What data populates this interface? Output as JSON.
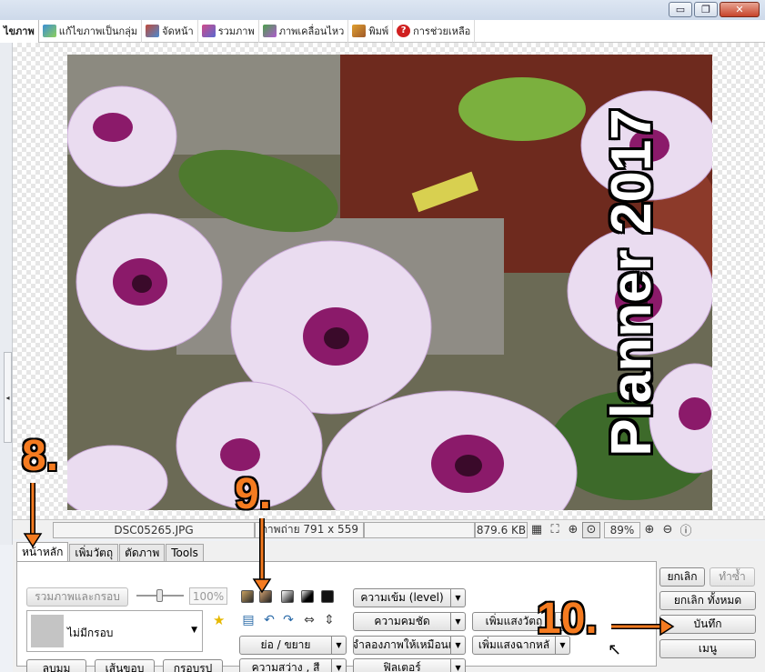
{
  "window": {
    "minimize_label": "▭",
    "restore_label": "❐",
    "close_label": "✕"
  },
  "menu": {
    "items": [
      {
        "label": "ไขภาพ",
        "icon": "edit-image-icon"
      },
      {
        "label": "แก้ไขภาพเป็นกลุ่ม",
        "icon": "batch-edit-icon"
      },
      {
        "label": "จัดหน้า",
        "icon": "page-layout-icon"
      },
      {
        "label": "รวมภาพ",
        "icon": "combine-icon"
      },
      {
        "label": "ภาพเคลื่อนไหว",
        "icon": "animation-icon"
      },
      {
        "label": "พิมพ์",
        "icon": "print-icon"
      },
      {
        "label": "การช่วยเหลือ",
        "icon": "help-icon"
      }
    ]
  },
  "photo": {
    "overlay_text": "Planner 2017"
  },
  "status": {
    "filename": "DSC05265.JPG",
    "dimensions": "ภาพถ่าย 791 x 559",
    "filesize": "879.6 KB",
    "zoom": "89%"
  },
  "tabs": [
    "หน้าหลัก",
    "เพิ่มวัตถุ",
    "ตัดภาพ",
    "Tools"
  ],
  "main_tab": {
    "merge_frame_label": "รวมภาพและกรอบ",
    "opacity_value": "100%",
    "frame_select": "ไม่มีกรอบ",
    "corner_label": "ลบมุม",
    "border_label": "เส้นขอบ",
    "frame_shape_label": "กรอบรูป",
    "resize_label": "ย่อ / ขยาย",
    "brightness_label": "ความสว่าง , สี",
    "level_label": "ความเข้ม (level)",
    "sharpness_label": "ความคมชัด",
    "simulate_label": "จำลองภาพให้เหมือนเ",
    "filter_label": "ฟิลเตอร์",
    "add_object_light_label": "เพิ่มแสงวัตถุ",
    "add_bg_light_label": "เพิ่มแสงฉากหลั"
  },
  "actions": {
    "cancel_label": "ยกเลิก",
    "redo_label": "ทำซ้ำ",
    "cancel_all_label": "ยกเลิก ทั้งหมด",
    "save_label": "บันทึก",
    "menu_label": "เมนู"
  },
  "annotations": {
    "step8": "8.",
    "step9": "9.",
    "step10": "10."
  },
  "colors": {
    "annotation": "#f57b20",
    "frame_thumb": "#c4c4c4"
  }
}
